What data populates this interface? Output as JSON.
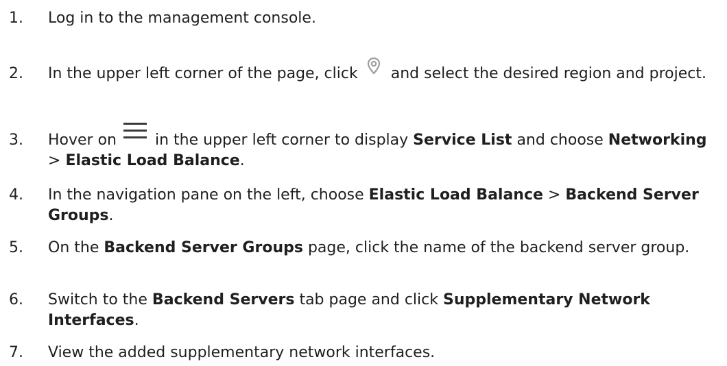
{
  "steps": [
    {
      "num": "1.",
      "text": "Log in to the management console."
    },
    {
      "num": "2.",
      "pre": "In the upper left corner of the page, click",
      "icon": "location-pin-icon",
      "post": "and select the desired region and project."
    },
    {
      "num": "3.",
      "pre": "Hover on",
      "icon": "menu-icon",
      "mid": "in the upper left corner to display",
      "b1": "Service List",
      "mid2": "and choose",
      "b2": "Networking",
      "sep": ">",
      "b3": "Elastic Load Balance",
      "end": "."
    },
    {
      "num": "4.",
      "pre": "In the navigation pane on the left, choose",
      "b1": "Elastic Load Balance",
      "sep": ">",
      "b2": "Backend Server Groups",
      "end": "."
    },
    {
      "num": "5.",
      "pre": "On the",
      "b1": "Backend Server Groups",
      "post": "page, click the name of the backend server group."
    },
    {
      "num": "6.",
      "pre": "Switch to the",
      "b1": "Backend Servers",
      "mid": "tab page and click",
      "b2": "Supplementary Network Interfaces",
      "end": "."
    },
    {
      "num": "7.",
      "text": "View the added supplementary network interfaces."
    }
  ],
  "colors": {
    "text": "#1f1f1f",
    "icon": "#9e9e9e",
    "menu_icon": "#3a3a3a"
  }
}
